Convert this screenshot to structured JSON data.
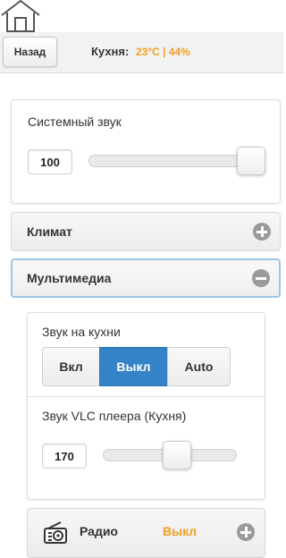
{
  "header": {
    "back_label": "Назад",
    "room_name": "Кухня:",
    "temperature": "23°C",
    "separator": "|",
    "humidity": "44%"
  },
  "system_sound": {
    "label": "Системный звук",
    "value": "100",
    "level_percent": 100
  },
  "sections": {
    "climate_title": "Климат",
    "multimedia_title": "Мультимедиа"
  },
  "multimedia": {
    "kitchen_sound_label": "Звук на кухни",
    "options": [
      "Вкл",
      "Выкл",
      "Auto"
    ],
    "selected_option": "Выкл",
    "vlc_label": "Звук VLC плеера (Кухня)",
    "vlc_value": "170",
    "vlc_level_percent": 57
  },
  "radio": {
    "label": "Радио",
    "status": "Выкл",
    "status_color": "#f0a020"
  },
  "colors": {
    "accent": "#3583c7",
    "highlight": "#f0a020"
  }
}
